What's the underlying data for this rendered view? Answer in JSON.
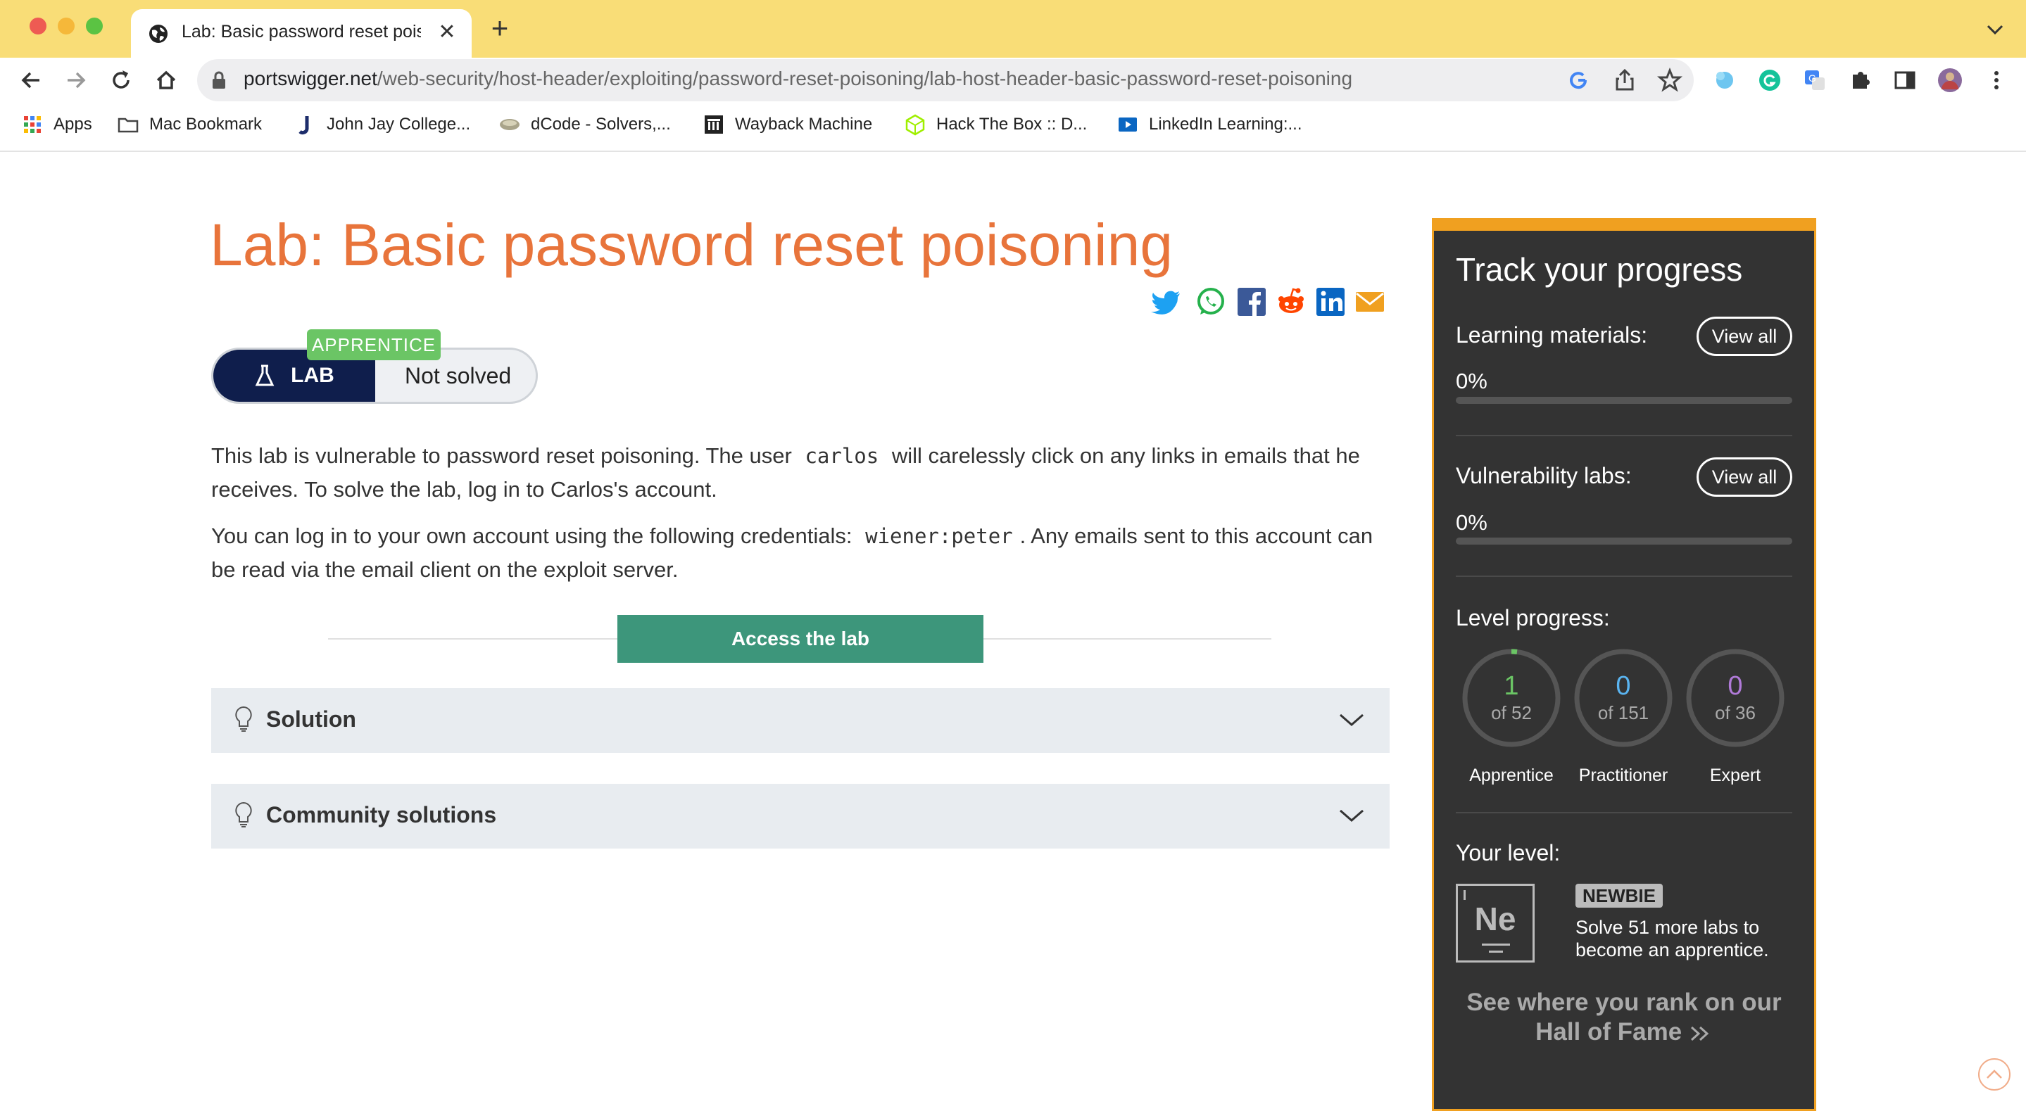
{
  "browser": {
    "tab_title": "Lab: Basic password reset pois",
    "url_domain": "portswigger.net",
    "url_path": "/web-security/host-header/exploiting/password-reset-poisoning/lab-host-header-basic-password-reset-poisoning",
    "bookmarks": [
      {
        "label": "Apps",
        "icon": "apps-grid-icon"
      },
      {
        "label": "Mac Bookmark",
        "icon": "folder-icon"
      },
      {
        "label": "John Jay College...",
        "icon": "jjay-icon"
      },
      {
        "label": "dCode - Solvers,...",
        "icon": "dcode-icon"
      },
      {
        "label": "Wayback Machine",
        "icon": "wayback-icon"
      },
      {
        "label": "Hack The Box :: D...",
        "icon": "htb-icon"
      },
      {
        "label": "LinkedIn Learning:...",
        "icon": "linkedin-learning-icon"
      }
    ]
  },
  "lab": {
    "title": "Lab: Basic password reset poisoning",
    "level_tag": "APPRENTICE",
    "badge_label": "LAB",
    "status": "Not solved",
    "intro_1": "This lab is vulnerable to password reset poisoning. The user",
    "user_code": "carlos",
    "intro_2": "will carelessly click on any links in emails that he receives. To solve the lab, log in to Carlos's account.",
    "creds_1": "You can log in to your own account using the following credentials:",
    "creds_code": "wiener:peter",
    "creds_2": ". Any emails sent to this account can be read via the email client on the exploit server.",
    "access_button": "Access the lab",
    "solution_label": "Solution",
    "community_label": "Community solutions"
  },
  "progress": {
    "title": "Track your progress",
    "learning_label": "Learning materials:",
    "learning_pct": "0%",
    "learning_value": 0,
    "vuln_label": "Vulnerability labs:",
    "vuln_pct": "0%",
    "vuln_value": 0,
    "view_all": "View all",
    "level_progress_label": "Level progress:",
    "levels": [
      {
        "count": "1",
        "of": "of 52",
        "name": "Apprentice",
        "color": "#6bc565"
      },
      {
        "count": "0",
        "of": "of 151",
        "name": "Practitioner",
        "color": "#5ab4f0"
      },
      {
        "count": "0",
        "of": "of 36",
        "name": "Expert",
        "color": "#b07ad8"
      }
    ],
    "your_level_label": "Your level:",
    "element_symbol": "Ne",
    "level_name": "NEWBIE",
    "solve_text": "Solve 51 more labs to become an apprentice.",
    "hall_of_fame": "See where you rank on our Hall of Fame"
  },
  "colors": {
    "title_orange": "#e8743b",
    "lab_navy": "#0f1e4c",
    "access_green": "#3d967b",
    "panel_border": "#f0a020",
    "chrome_yellow": "#f9dd77"
  }
}
